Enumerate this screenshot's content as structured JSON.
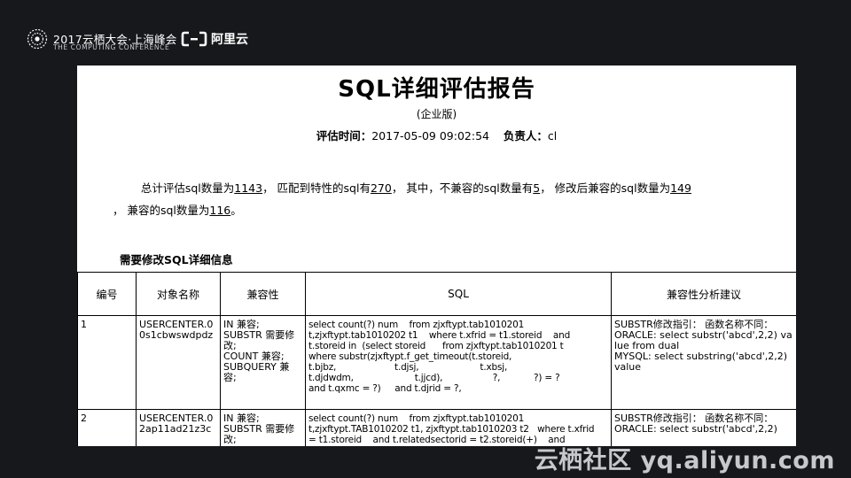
{
  "header": {
    "conference_title": "2017云栖大会·上海峰会",
    "conference_subtitle": "THE COMPUTING CONFERENCE",
    "brand_name": "阿里云"
  },
  "report": {
    "title": "SQL详细评估报告",
    "edition": "(企业版)",
    "eval_time_label": "评估时间：",
    "eval_time_value": "2017-05-09 09:02:54",
    "owner_label": "负责人：",
    "owner_value": "cl",
    "summary": {
      "p1": "总计评估sql数量为",
      "total": "1143",
      "p2": "， 匹配到特性的sql有",
      "matched": "270",
      "p3": "， 其中，不兼容的sql数量有",
      "incompatible": "5",
      "p4": "， 修改后兼容的sql数量为",
      "fixed": "149",
      "p5": "， 兼容的sql数量为",
      "compatible": "116",
      "p6": "。"
    },
    "section_heading": "需要修改SQL详细信息"
  },
  "table": {
    "headers": [
      "编号",
      "对象名称",
      "兼容性",
      "SQL",
      "兼容性分析建议"
    ],
    "rows": [
      {
        "id": "1",
        "object": "USERCENTER.00s1cbwswdpdz",
        "compat": "IN 兼容;\nSUBSTR 需要修改;\nCOUNT 兼容;\nSUBQUERY 兼容;",
        "sql": "select count(?) num    from zjxftypt.tab1010201\nt,zjxftypt.tab1010202 t1    where t.xfrid = t1.storeid    and\nt.storeid in  (select storeid      from zjxftypt.tab1010201 t\nwhere substr(zjxftypt.f_get_timeout(t.storeid,\nt.bjbz,                     t.djsj,                      t.xbsj,\nt.djdwdm,                      t.jjcd),                  ?,            ?) = ?\nand t.qxmc = ?)     and t.djrid = ?,",
        "advice": "SUBSTR修改指引： 函数名称不同：\nORACLE: select substr('abcd',2,2) value from dual\nMYSQL: select substring('abcd',2,2) value"
      },
      {
        "id": "2",
        "object": "USERCENTER.02ap11ad21z3c",
        "compat": "IN 兼容;\nSUBSTR 需要修改;",
        "sql": "select count(?) num    from zjxftypt.tab1010201\nt,zjxftypt.TAB1010202 t1, zjxftypt.tab1010203 t2   where t.xfrid\n= t1.storeid    and t.relatedsectorid = t2.storeid(+)    and",
        "advice": "SUBSTR修改指引： 函数名称不同：\nORACLE: select substr('abcd',2,2)"
      }
    ]
  },
  "watermark": "云栖社区 yq.aliyun.com"
}
